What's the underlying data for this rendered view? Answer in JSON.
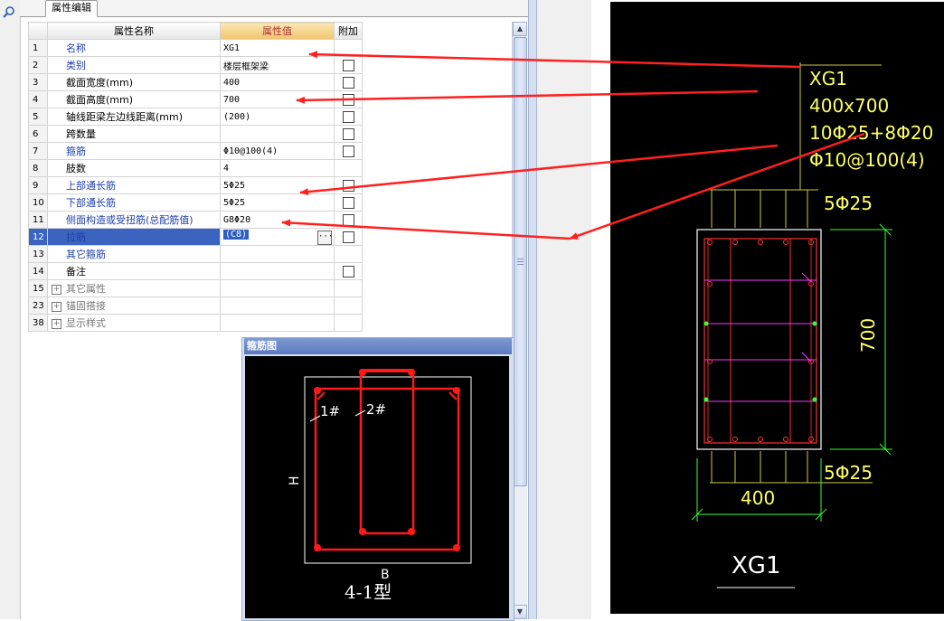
{
  "tab": {
    "label": "属性编辑"
  },
  "grid": {
    "headers": {
      "name": "属性名称",
      "value": "属性值",
      "extra": "附加"
    },
    "rows": [
      {
        "n": "1",
        "name": "名称",
        "value": "XG1",
        "blue": true,
        "check": false
      },
      {
        "n": "2",
        "name": "类别",
        "value": "楼层框架梁",
        "blue": true,
        "check": true
      },
      {
        "n": "3",
        "name": "截面宽度(mm)",
        "value": "400",
        "blue": false,
        "check": true
      },
      {
        "n": "4",
        "name": "截面高度(mm)",
        "value": "700",
        "blue": false,
        "check": true
      },
      {
        "n": "5",
        "name": "轴线距梁左边线距离(mm)",
        "value": "(200)",
        "blue": false,
        "check": true
      },
      {
        "n": "6",
        "name": "跨数量",
        "value": "",
        "blue": false,
        "check": true
      },
      {
        "n": "7",
        "name": "箍筋",
        "value": "Φ10@100(4)",
        "blue": true,
        "check": true
      },
      {
        "n": "8",
        "name": "肢数",
        "value": "4",
        "blue": false,
        "check": false
      },
      {
        "n": "9",
        "name": "上部通长筋",
        "value": "5Φ25",
        "blue": true,
        "check": true
      },
      {
        "n": "10",
        "name": "下部通长筋",
        "value": "5Φ25",
        "blue": true,
        "check": true
      },
      {
        "n": "11",
        "name": "侧面构造或受扭筋(总配筋值)",
        "value": "G8Φ20",
        "blue": true,
        "check": true
      },
      {
        "n": "12",
        "name": "拉筋",
        "value": "(C8)",
        "blue": true,
        "check": true,
        "selected": true
      },
      {
        "n": "13",
        "name": "其它箍筋",
        "value": "",
        "blue": true,
        "check": false
      },
      {
        "n": "14",
        "name": "备注",
        "value": "",
        "blue": false,
        "check": true
      }
    ],
    "groups": [
      {
        "n": "15",
        "name": "其它属性"
      },
      {
        "n": "23",
        "name": "锚固搭接"
      },
      {
        "n": "38",
        "name": "显示样式"
      }
    ]
  },
  "stirrup_window": {
    "title": "箍筋图",
    "label_1": "1#",
    "label_2": "2#",
    "label_h": "H",
    "label_b": "B",
    "type": "4-1型"
  },
  "cad": {
    "beam_name": "XG1",
    "section": "400x700",
    "long_bars": "10Φ25+8Φ20",
    "stirrup": "Φ10@100(4)",
    "top_bars": "5Φ25",
    "bottom_bars": "5Φ25",
    "height_dim": "700",
    "width_dim": "400",
    "title": "XG1"
  },
  "colors": {
    "arrow": "#ff2020",
    "cad_text": "#ffff66",
    "cad_dim": "#33ff33",
    "cad_rebar": "#ff3333",
    "cad_tie": "#ff33ff"
  }
}
